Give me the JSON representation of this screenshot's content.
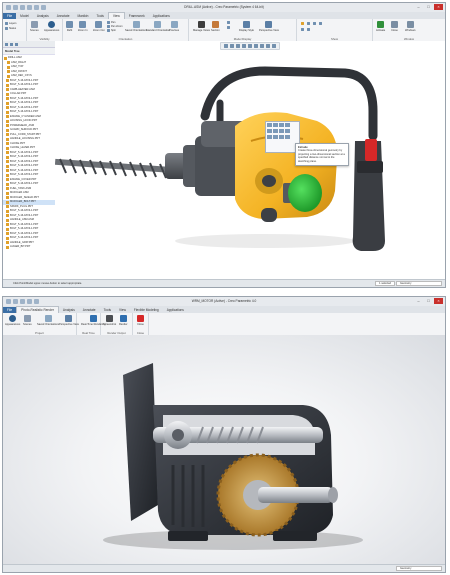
{
  "win1": {
    "title": "DRILL.ASM (Active) - Creo Parametric (System 4 64-bit)",
    "tabs": [
      "File",
      "Model",
      "Analysis",
      "Annotate",
      "Manikin",
      "Tools",
      "View",
      "Framework",
      "Applications"
    ],
    "active_tab": "View",
    "groups": [
      {
        "name": "",
        "buttons": [
          "Layers",
          "Status"
        ]
      },
      {
        "name": "Visibility",
        "buttons": [
          "Scenes",
          "Appearances"
        ]
      },
      {
        "name": "Orientation",
        "buttons": [
          "Refit",
          "Zoom In",
          "Zoom Out",
          "Pan",
          "Pan Zoom",
          "Spin",
          "Saved Orientations",
          "Standard Orientation",
          "Previous"
        ]
      },
      {
        "name": "Model Display",
        "buttons": [
          "Manage Views",
          "Section",
          "Display Style",
          "Perspective View"
        ]
      },
      {
        "name": "Show",
        "buttons": []
      },
      {
        "name": "Window",
        "buttons": [
          "Activate",
          "Close",
          "Windows"
        ]
      }
    ],
    "tree_header": "Model Tree",
    "tree_items": [
      "DRILL.ASM",
      "ASM_RIGHT",
      "ASM_TOP",
      "ASM_FRONT",
      "ASM_DEF_CSYS",
      "BOLT_5-16-18X3-1.PRT",
      "BOLT_5-16-18X3-1.PRT",
      "CARB-HEATER.ASM",
      "COLLAR.PRT",
      "BOLT_5-16-18X3-1.PRT",
      "BOLT_5-16-18X3-1.PRT",
      "BOLT_5-16-18X3-1.PRT",
      "BOLT_5-16-18X3-1.PRT",
      "ENGINE_CYLINDER.ASM",
      "HOUSING_HOOD.PRT",
      "POWERHEAD_ASM",
      "GUARD_SHROUD.PRT",
      "PULL_CORD_START.PRT",
      "HANDLE_HOUSING.PRT",
      "CHOKE.PRT",
      "CHOKE_LEVER.PRT",
      "BOLT_5-16-18X3-1.PRT",
      "BOLT_5-16-18X3-1.PRT",
      "BOLT_5-16-18X3-1.PRT",
      "BOLT_5-16-18X3-1.PRT",
      "BOLT_5-16-18X3-1.PRT",
      "BOLT_5-16-18X3-1.PRT",
      "ENGINE_COVER.PRT",
      "BOLT_5-16-18X3-1.PRT",
      "FUEL_TANK.ASM",
      "MUFFLER.ASM",
      "MUFFLER_SHIELD.PRT",
      "MUFFLER_BOLT.PRT",
      "SPARK_PLUG.PRT",
      "BOLT_5-16-18X3-1.PRT",
      "BOLT_5-16-18X3-1.PRT",
      "HANDLE_ASM.ASM",
      "BOLT_5-16-18X3-1.PRT",
      "BOLT_5-16-18X3-1.PRT",
      "BOLT_5-16-18X3-1.PRT",
      "BOLT_5-16-18X3-1.PRT",
      "HANDLE_GRIP.PRT",
      "AUGER_BIT.PRT"
    ],
    "tree_selected_index": 32,
    "tooltip_title": "Extrude",
    "tooltip_text": "Create three-dimensional geometry by projecting a two-dimensional section at a specified distance normal to the sketching plane.",
    "status_message": "Click Point/Model upper-mouse-button to select appropriate.",
    "status_selected": "1 selected",
    "status_filter": "Geometry"
  },
  "win2": {
    "title": "WRM_MOTOR (Active) - Creo Parametric 4.0",
    "tabs": [
      "File",
      "Photo-Realistic Render",
      "Analysis",
      "Annotate",
      "Tools",
      "View",
      "Flexible Modeling",
      "Applications"
    ],
    "active_tab": "Photo-Realistic Render",
    "groups": [
      {
        "name": "Project",
        "buttons": [
          "Appearances",
          "Scenes",
          "Saved Orientations",
          "Perspective View"
        ]
      },
      {
        "name": "Real Time",
        "buttons": [
          "Real-Time Rendering"
        ]
      },
      {
        "name": "Render Output",
        "buttons": [
          "Screenshot",
          "Render"
        ]
      },
      {
        "name": "Close",
        "buttons": [
          "Close"
        ]
      }
    ],
    "status_filter": "Geometry"
  },
  "colors": {
    "engine_yellow": "#f4b324",
    "selection_green": "#2ebd3a",
    "accent_blue": "#3a6ea5",
    "trigger_red": "#d62828",
    "bronze_gear": "#c99a3c"
  }
}
